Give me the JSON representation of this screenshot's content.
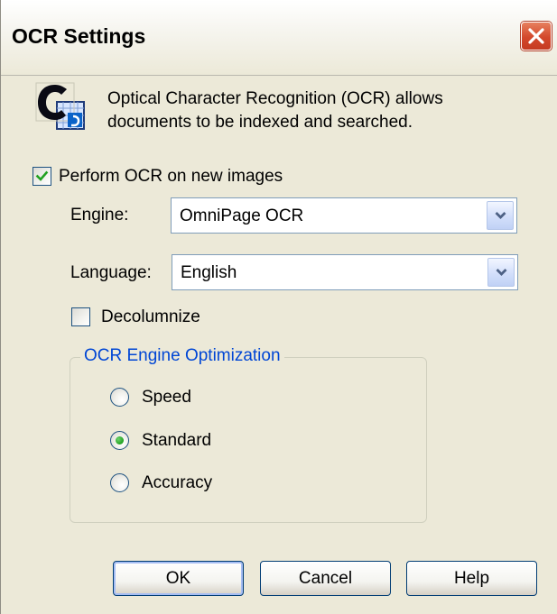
{
  "window": {
    "title": "OCR Settings"
  },
  "header": {
    "description_line1": "Optical Character Recognition (OCR) allows",
    "description_line2": "documents to be indexed and searched."
  },
  "options": {
    "perform_ocr": {
      "label": "Perform OCR on new images",
      "checked": true
    },
    "engine": {
      "label": "Engine:",
      "value": "OmniPage OCR"
    },
    "language": {
      "label": "Language:",
      "value": "English"
    },
    "decolumnize": {
      "label": "Decolumnize",
      "checked": false
    }
  },
  "optimization": {
    "legend": "OCR Engine Optimization",
    "choices": [
      {
        "label": "Speed",
        "selected": false
      },
      {
        "label": "Standard",
        "selected": true
      },
      {
        "label": "Accuracy",
        "selected": false
      }
    ]
  },
  "buttons": {
    "ok": "OK",
    "cancel": "Cancel",
    "help": "Help"
  },
  "icons": {
    "close": "close-icon",
    "app": "ocr-document-icon",
    "checkmark": "checkmark-icon",
    "dropdown": "chevron-down-icon"
  },
  "colors": {
    "dialog_background": "#ece9d8",
    "close_button": "#d3482c",
    "group_legend": "#0046d5",
    "check_green": "#21a121",
    "control_border": "#1c5180"
  }
}
